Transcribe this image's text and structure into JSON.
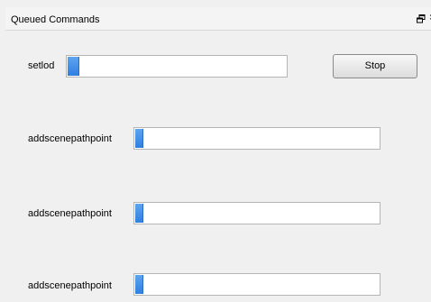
{
  "window": {
    "title": "Queued Commands",
    "float_icon": "restore-window-icon",
    "close_icon": "close-icon",
    "close_glyph": "×"
  },
  "commands": [
    {
      "label": "setlod",
      "progress_percent": 5
    },
    {
      "label": "addscenepathpoint",
      "progress_percent": 3
    },
    {
      "label": "addscenepathpoint",
      "progress_percent": 3
    },
    {
      "label": "addscenepathpoint",
      "progress_percent": 3
    }
  ],
  "stop_button": {
    "label": "Stop"
  },
  "colors": {
    "accent_fill": "#2f7fe0",
    "background": "#f0f0f0"
  }
}
